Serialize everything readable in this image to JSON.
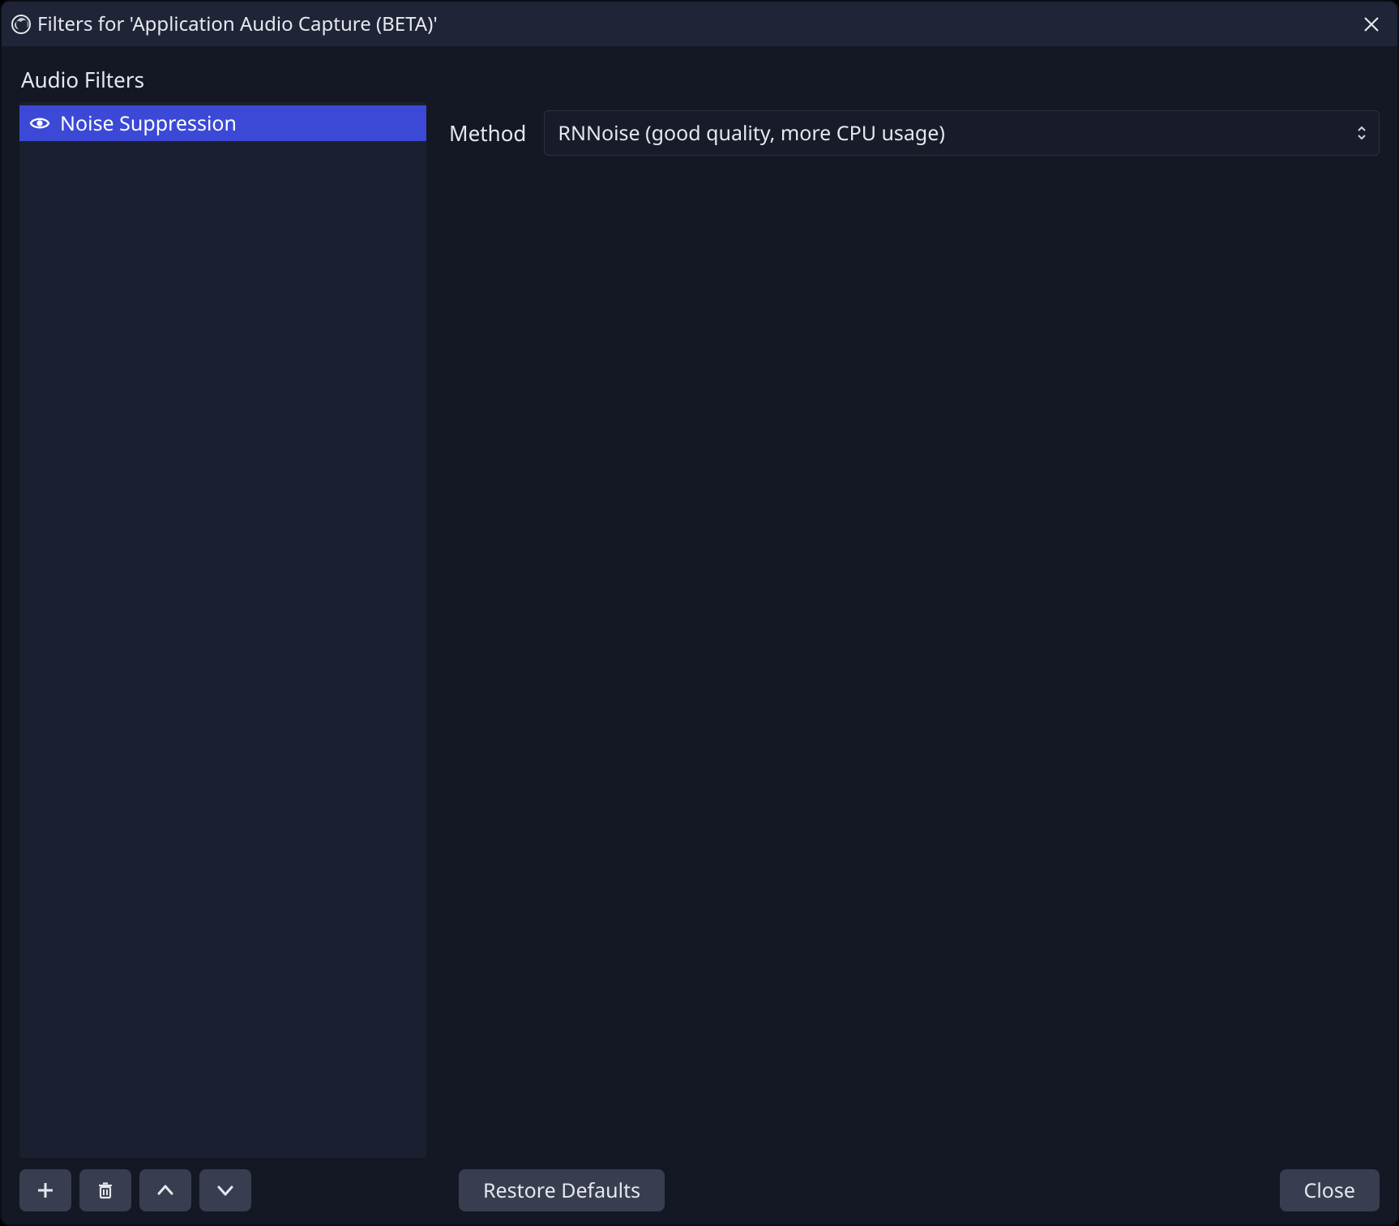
{
  "titlebar": {
    "title": "Filters for 'Application Audio Capture (BETA)'"
  },
  "section_label": "Audio Filters",
  "filters": {
    "items": [
      {
        "label": "Noise Suppression",
        "visible": true,
        "selected": true
      }
    ]
  },
  "props": {
    "method_label": "Method",
    "method_value": "RNNoise (good quality, more CPU usage)"
  },
  "buttons": {
    "restore_defaults": "Restore Defaults",
    "close": "Close"
  }
}
